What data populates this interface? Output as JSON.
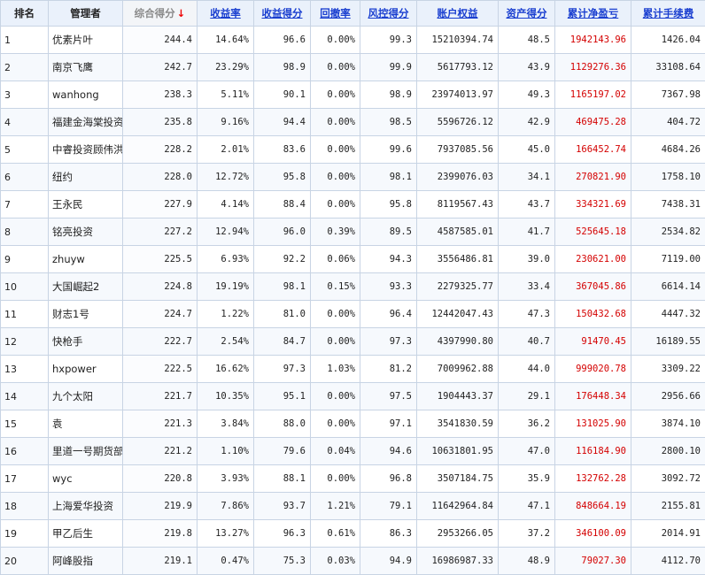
{
  "colors": {
    "header_bg": "#eaf1fb",
    "link": "#1a3fd0",
    "profit_red": "#d40000",
    "sort_arrow": "#e00000",
    "border": "#c8d4e4"
  },
  "headers": [
    {
      "label": "排名"
    },
    {
      "label": "管理者"
    },
    {
      "label": "综合得分",
      "sort_icon": "↓"
    },
    {
      "label": "收益率"
    },
    {
      "label": "收益得分"
    },
    {
      "label": "回撤率"
    },
    {
      "label": "风控得分"
    },
    {
      "label": "账户权益"
    },
    {
      "label": "资产得分"
    },
    {
      "label": "累计净盈亏"
    },
    {
      "label": "累计手续费"
    }
  ],
  "rows": [
    [
      "1",
      "优素片叶",
      "244.4",
      "14.64%",
      "96.6",
      "0.00%",
      "99.3",
      "15210394.74",
      "48.5",
      "1942143.96",
      "1426.04"
    ],
    [
      "2",
      "南京飞鹰",
      "242.7",
      "23.29%",
      "98.9",
      "0.00%",
      "99.9",
      "5617793.12",
      "43.9",
      "1129276.36",
      "33108.64"
    ],
    [
      "3",
      "wanhong",
      "238.3",
      "5.11%",
      "90.1",
      "0.00%",
      "98.9",
      "23974013.97",
      "49.3",
      "1165197.02",
      "7367.98"
    ],
    [
      "4",
      "福建金海棠投资",
      "235.8",
      "9.16%",
      "94.4",
      "0.00%",
      "98.5",
      "5596726.12",
      "42.9",
      "469475.28",
      "404.72"
    ],
    [
      "5",
      "中睿投资顾伟洪",
      "228.2",
      "2.01%",
      "83.6",
      "0.00%",
      "99.6",
      "7937085.56",
      "45.0",
      "166452.74",
      "4684.26"
    ],
    [
      "6",
      "纽约",
      "228.0",
      "12.72%",
      "95.8",
      "0.00%",
      "98.1",
      "2399076.03",
      "34.1",
      "270821.90",
      "1758.10"
    ],
    [
      "7",
      "王永民",
      "227.9",
      "4.14%",
      "88.4",
      "0.00%",
      "95.8",
      "8119567.43",
      "43.7",
      "334321.69",
      "7438.31"
    ],
    [
      "8",
      "铭亮投资",
      "227.2",
      "12.94%",
      "96.0",
      "0.39%",
      "89.5",
      "4587585.01",
      "41.7",
      "525645.18",
      "2534.82"
    ],
    [
      "9",
      "zhuyw",
      "225.5",
      "6.93%",
      "92.2",
      "0.06%",
      "94.3",
      "3556486.81",
      "39.0",
      "230621.00",
      "7119.00"
    ],
    [
      "10",
      "大国崛起2",
      "224.8",
      "19.19%",
      "98.1",
      "0.15%",
      "93.3",
      "2279325.77",
      "33.4",
      "367045.86",
      "6614.14"
    ],
    [
      "11",
      "财志1号",
      "224.7",
      "1.22%",
      "81.0",
      "0.00%",
      "96.4",
      "12442047.43",
      "47.3",
      "150432.68",
      "4447.32"
    ],
    [
      "12",
      "快枪手",
      "222.7",
      "2.54%",
      "84.7",
      "0.00%",
      "97.3",
      "4397990.80",
      "40.7",
      "91470.45",
      "16189.55"
    ],
    [
      "13",
      "hxpower",
      "222.5",
      "16.62%",
      "97.3",
      "1.03%",
      "81.2",
      "7009962.88",
      "44.0",
      "999020.78",
      "3309.22"
    ],
    [
      "14",
      "九个太阳",
      "221.7",
      "10.35%",
      "95.1",
      "0.00%",
      "97.5",
      "1904443.37",
      "29.1",
      "176448.34",
      "2956.66"
    ],
    [
      "15",
      "袁",
      "221.3",
      "3.84%",
      "88.0",
      "0.00%",
      "97.1",
      "3541830.59",
      "36.2",
      "131025.90",
      "3874.10"
    ],
    [
      "16",
      "里道一号期货部",
      "221.2",
      "1.10%",
      "79.6",
      "0.04%",
      "94.6",
      "10631801.95",
      "47.0",
      "116184.90",
      "2800.10"
    ],
    [
      "17",
      "wyc",
      "220.8",
      "3.93%",
      "88.1",
      "0.00%",
      "96.8",
      "3507184.75",
      "35.9",
      "132762.28",
      "3092.72"
    ],
    [
      "18",
      "上海爱华投资",
      "219.9",
      "7.86%",
      "93.7",
      "1.21%",
      "79.1",
      "11642964.84",
      "47.1",
      "848664.19",
      "2155.81"
    ],
    [
      "19",
      "甲乙后生",
      "219.8",
      "13.27%",
      "96.3",
      "0.61%",
      "86.3",
      "2953266.05",
      "37.2",
      "346100.09",
      "2014.91"
    ],
    [
      "20",
      "阿峰股指",
      "219.1",
      "0.47%",
      "75.3",
      "0.03%",
      "94.9",
      "16986987.33",
      "48.9",
      "79027.30",
      "4112.70"
    ]
  ]
}
